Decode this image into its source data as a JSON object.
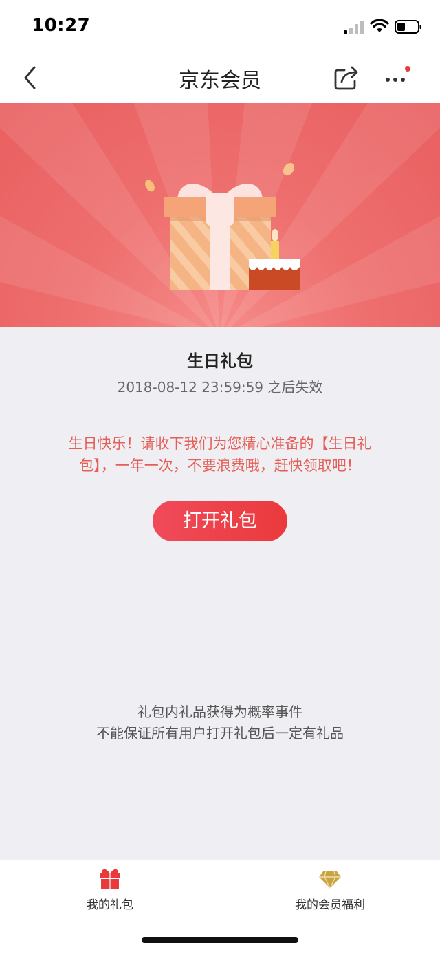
{
  "status_bar": {
    "time": "10:27"
  },
  "nav": {
    "title": "京东会员"
  },
  "banner": {
    "illustration": "gift-box-with-birthday-cake"
  },
  "gift": {
    "title": "生日礼包",
    "expiry": "2018-08-12 23:59:59 之后失效",
    "message": "生日快乐！请收下我们为您精心准备的【生日礼包】，一年一次，不要浪费哦，赶快领取吧！",
    "open_button": "打开礼包"
  },
  "notice": {
    "line1": "礼包内礼品获得为概率事件",
    "line2": "不能保证所有用户打开礼包后一定有礼品"
  },
  "tabs": [
    {
      "label": "我的礼包",
      "icon": "gift-icon"
    },
    {
      "label": "我的会员福利",
      "icon": "diamond-icon"
    }
  ],
  "colors": {
    "accent": "#e9393b",
    "banner": "#ee6f6e",
    "message": "#e65f57"
  }
}
